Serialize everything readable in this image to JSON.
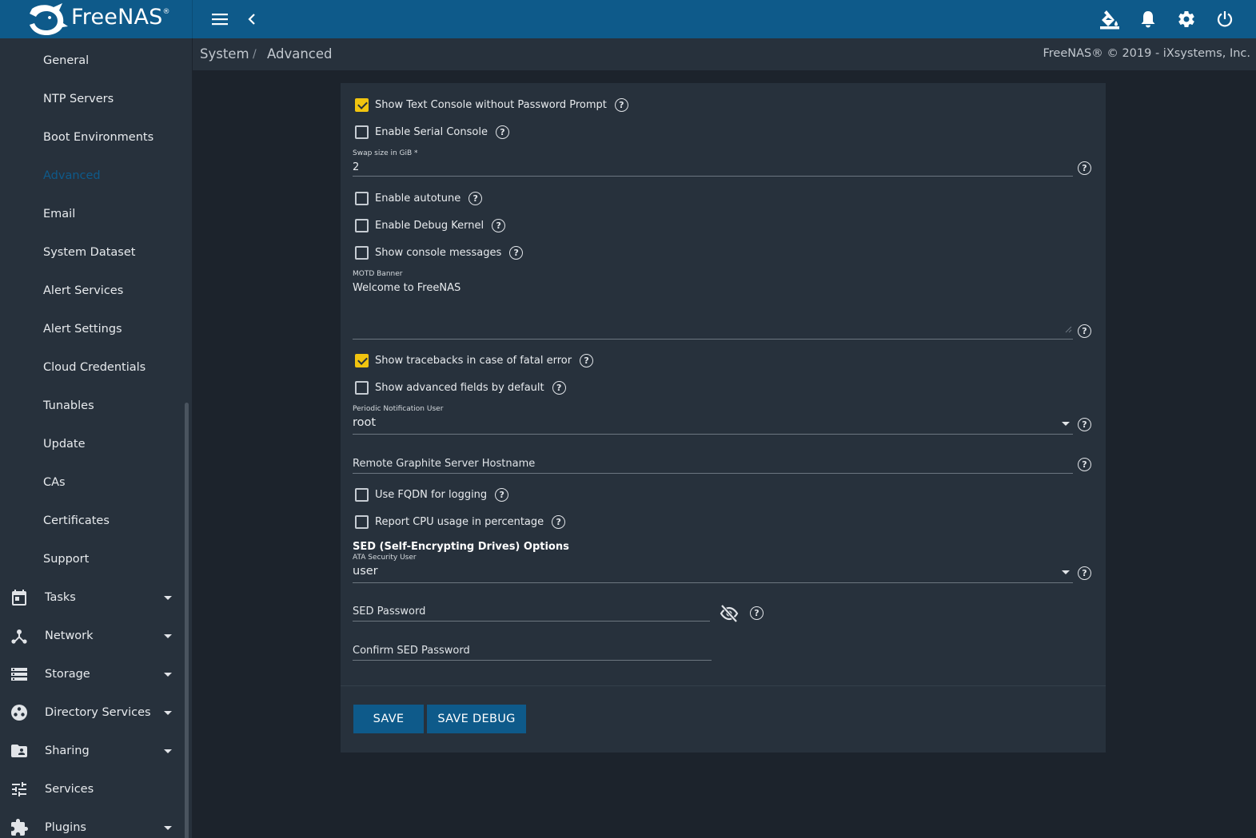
{
  "app": {
    "name": "FreeNAS",
    "trademark": "®"
  },
  "breadcrumb": {
    "section": "System",
    "separator": "/",
    "page": "Advanced",
    "copyright": "FreeNAS® © 2019 - iXsystems, Inc."
  },
  "topbar": {
    "icons": [
      "menu-icon",
      "back-chevron-icon",
      "theme-paint-icon",
      "notifications-bell-icon",
      "settings-gear-icon",
      "power-icon"
    ]
  },
  "sidebar": {
    "items": [
      {
        "label": "General"
      },
      {
        "label": "NTP Servers"
      },
      {
        "label": "Boot Environments"
      },
      {
        "label": "Advanced",
        "active": true
      },
      {
        "label": "Email"
      },
      {
        "label": "System Dataset"
      },
      {
        "label": "Alert Services"
      },
      {
        "label": "Alert Settings"
      },
      {
        "label": "Cloud Credentials"
      },
      {
        "label": "Tunables"
      },
      {
        "label": "Update"
      },
      {
        "label": "CAs"
      },
      {
        "label": "Certificates"
      },
      {
        "label": "Support"
      }
    ],
    "sections": [
      {
        "label": "Tasks",
        "icon": "calendar-icon"
      },
      {
        "label": "Network",
        "icon": "network-icon"
      },
      {
        "label": "Storage",
        "icon": "storage-icon"
      },
      {
        "label": "Directory Services",
        "icon": "directory-services-icon"
      },
      {
        "label": "Sharing",
        "icon": "sharing-folder-icon"
      },
      {
        "label": "Services",
        "icon": "services-tune-icon"
      },
      {
        "label": "Plugins",
        "icon": "plugins-puzzle-icon"
      }
    ]
  },
  "form": {
    "show_text_console": {
      "label": "Show Text Console without Password Prompt",
      "checked": true
    },
    "serial_console": {
      "label": "Enable Serial Console",
      "checked": false
    },
    "swap": {
      "label": "Swap size in GiB *",
      "value": "2"
    },
    "autotune": {
      "label": "Enable autotune",
      "checked": false
    },
    "debug_kernel": {
      "label": "Enable Debug Kernel",
      "checked": false
    },
    "console_messages": {
      "label": "Show console messages",
      "checked": false
    },
    "motd": {
      "label": "MOTD Banner",
      "value": "Welcome to FreeNAS"
    },
    "tracebacks": {
      "label": "Show tracebacks in case of fatal error",
      "checked": true
    },
    "advanced_fields": {
      "label": "Show advanced fields by default",
      "checked": false
    },
    "periodic_user": {
      "label": "Periodic Notification User",
      "value": "root"
    },
    "graphite": {
      "placeholder": "Remote Graphite Server Hostname"
    },
    "fqdn": {
      "label": "Use FQDN for logging",
      "checked": false
    },
    "cpu_percent": {
      "label": "Report CPU usage in percentage",
      "checked": false
    },
    "sed_section": "SED (Self-Encrypting Drives) Options",
    "ata_user": {
      "label": "ATA Security User",
      "value": "user"
    },
    "sed_password": {
      "placeholder": "SED Password"
    },
    "confirm_sed_password": {
      "placeholder": "Confirm SED Password"
    },
    "help_glyph": "?"
  },
  "buttons": {
    "save": "SAVE",
    "save_debug": "SAVE DEBUG"
  },
  "colors": {
    "topbar": "#0e5a8a",
    "sidebar": "#27313c",
    "background": "#1c232c",
    "checkbox_checked": "#f1c40f",
    "button": "#0e5a8a"
  }
}
